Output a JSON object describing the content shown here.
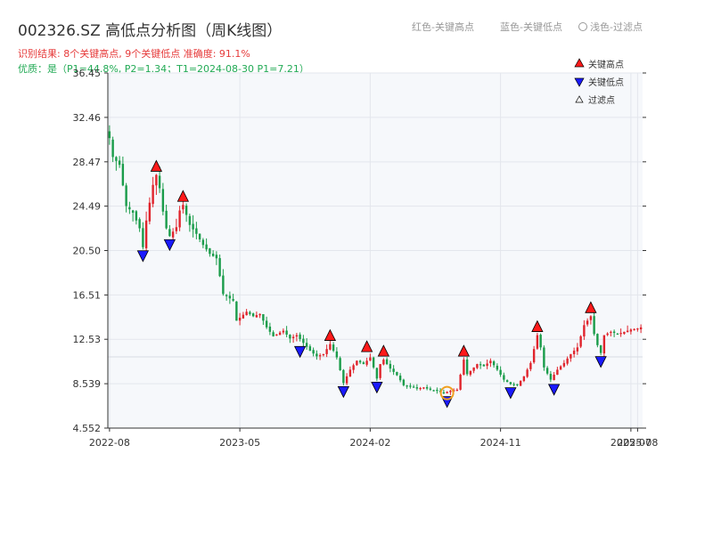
{
  "header": {
    "title": "002326.SZ 高低点分析图（周K线图）",
    "subtitle_result": "识别结果: 8个关键高点, 9个关键低点   准确度: 91.1%",
    "subtitle_quality": "优质：是（P1=44.8%, P2=1.34；T1=2024-08-30 P1=7.21）"
  },
  "top_legend": {
    "red": "红色-关键高点",
    "blue": "蓝色-关键低点",
    "light": "浅色-过滤点"
  },
  "colors": {
    "up": "#e0242c",
    "down": "#1a9c4a",
    "high_marker": "#ff1a1a",
    "low_marker": "#1a1aff",
    "highlight_ring": "#f0a020",
    "plot_bg": "#f6f8fb",
    "grid": "#e3e6ec"
  },
  "chart_data": {
    "type": "candlestick",
    "y_ticks": [
      "4.552",
      "8.539",
      "12.53",
      "16.51",
      "20.50",
      "24.49",
      "28.47",
      "32.46",
      "36.45"
    ],
    "ylim": [
      4.552,
      36.45
    ],
    "x_ticks": [
      {
        "label": "2022-08",
        "week": 0
      },
      {
        "label": "2023-05",
        "week": 39
      },
      {
        "label": "2024-02",
        "week": 78
      },
      {
        "label": "2024-11",
        "week": 117
      },
      {
        "label": "2025-07",
        "week": 156
      },
      {
        "label": "2025-08",
        "week": 158
      }
    ],
    "n_weeks": 160,
    "grid": true,
    "legend": {
      "position": "top-right",
      "items": [
        {
          "label": "关键高点",
          "marker": "high"
        },
        {
          "label": "关键低点",
          "marker": "low"
        },
        {
          "label": "过滤点",
          "marker": "filtered"
        }
      ]
    },
    "close_path": [
      [
        0,
        30.6
      ],
      [
        1,
        28.9
      ],
      [
        3,
        28.2
      ],
      [
        5,
        24.5
      ],
      [
        7,
        23.9
      ],
      [
        9,
        22.5
      ],
      [
        10,
        20.8
      ],
      [
        11,
        23.2
      ],
      [
        13,
        26.4
      ],
      [
        14,
        27.3
      ],
      [
        15,
        26.1
      ],
      [
        16,
        24.0
      ],
      [
        17,
        22.5
      ],
      [
        18,
        21.8
      ],
      [
        20,
        22.6
      ],
      [
        21,
        24.1
      ],
      [
        22,
        24.6
      ],
      [
        24,
        22.8
      ],
      [
        26,
        22.0
      ],
      [
        28,
        21.0
      ],
      [
        30,
        20.2
      ],
      [
        32,
        19.8
      ],
      [
        34,
        16.6
      ],
      [
        37,
        16.0
      ],
      [
        38,
        14.2
      ],
      [
        41,
        15.0
      ],
      [
        43,
        14.6
      ],
      [
        45,
        14.8
      ],
      [
        47,
        13.6
      ],
      [
        49,
        12.8
      ],
      [
        52,
        13.3
      ],
      [
        54,
        12.6
      ],
      [
        56,
        12.9
      ],
      [
        60,
        11.5
      ],
      [
        62,
        11.0
      ],
      [
        64,
        11.2
      ],
      [
        66,
        12.1
      ],
      [
        68,
        10.9
      ],
      [
        70,
        8.6
      ],
      [
        72,
        9.8
      ],
      [
        74,
        10.6
      ],
      [
        76,
        10.3
      ],
      [
        78,
        10.9
      ],
      [
        79,
        10.0
      ],
      [
        80,
        9.0
      ],
      [
        81,
        10.3
      ],
      [
        82,
        10.7
      ],
      [
        84,
        9.9
      ],
      [
        86,
        9.3
      ],
      [
        88,
        8.4
      ],
      [
        90,
        8.3
      ],
      [
        92,
        8.1
      ],
      [
        94,
        8.2
      ],
      [
        96,
        8.0
      ],
      [
        98,
        7.9
      ],
      [
        100,
        7.7
      ],
      [
        102,
        7.9
      ],
      [
        104,
        8.0
      ],
      [
        106,
        10.7
      ],
      [
        107,
        9.4
      ],
      [
        108,
        9.7
      ],
      [
        110,
        10.3
      ],
      [
        112,
        10.1
      ],
      [
        114,
        10.6
      ],
      [
        116,
        9.8
      ],
      [
        118,
        8.9
      ],
      [
        120,
        8.5
      ],
      [
        122,
        8.4
      ],
      [
        124,
        9.2
      ],
      [
        126,
        10.4
      ],
      [
        128,
        12.9
      ],
      [
        129,
        11.8
      ],
      [
        130,
        10.0
      ],
      [
        132,
        8.9
      ],
      [
        134,
        9.8
      ],
      [
        136,
        10.4
      ],
      [
        138,
        11.2
      ],
      [
        140,
        11.8
      ],
      [
        142,
        13.8
      ],
      [
        144,
        14.6
      ],
      [
        145,
        13.0
      ],
      [
        146,
        12.0
      ],
      [
        147,
        11.3
      ],
      [
        148,
        12.9
      ],
      [
        150,
        13.2
      ],
      [
        152,
        13.0
      ],
      [
        154,
        13.2
      ],
      [
        156,
        13.4
      ],
      [
        158,
        13.5
      ],
      [
        159,
        13.6
      ]
    ],
    "key_highs": [
      {
        "week": 14,
        "price": 27.3
      },
      {
        "week": 22,
        "price": 24.6
      },
      {
        "week": 66,
        "price": 12.1
      },
      {
        "week": 77,
        "price": 11.1
      },
      {
        "week": 82,
        "price": 10.7
      },
      {
        "week": 106,
        "price": 10.7
      },
      {
        "week": 128,
        "price": 12.9
      },
      {
        "week": 144,
        "price": 14.6
      }
    ],
    "key_lows": [
      {
        "week": 10,
        "price": 20.8
      },
      {
        "week": 18,
        "price": 21.8
      },
      {
        "week": 57,
        "price": 12.2
      },
      {
        "week": 70,
        "price": 8.6
      },
      {
        "week": 80,
        "price": 9.0
      },
      {
        "week": 101,
        "price": 7.7
      },
      {
        "week": 120,
        "price": 8.5
      },
      {
        "week": 133,
        "price": 8.8
      },
      {
        "week": 147,
        "price": 11.3
      }
    ],
    "highlighted_point": {
      "week": 101,
      "price": 7.7
    }
  }
}
